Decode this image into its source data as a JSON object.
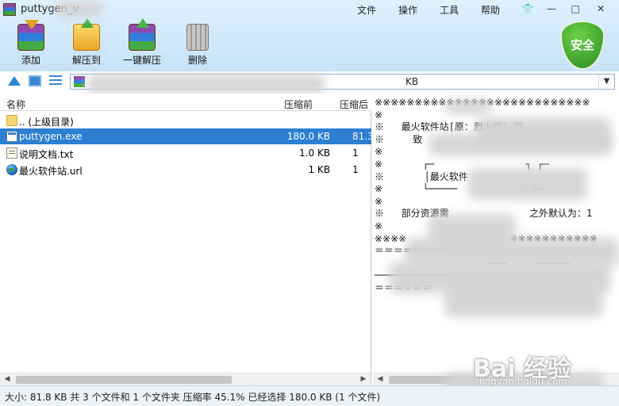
{
  "window": {
    "title": "puttygen_v",
    "menus": [
      "文件",
      "操作",
      "工具",
      "帮助"
    ],
    "controls": [
      "—",
      "□",
      "✕"
    ]
  },
  "toolbar": {
    "add_label": "添加",
    "extract_label": "解压到",
    "one_click_label": "一键解压",
    "delete_label": "删除"
  },
  "security_badge": "安全",
  "address": {
    "path_suffix": "KB"
  },
  "list": {
    "columns": [
      "名称",
      "压缩前",
      "压缩后"
    ],
    "rows": [
      {
        "name": ".. (上级目录)",
        "size": "",
        "packed": "",
        "icon": "folder-icon"
      },
      {
        "name": "puttygen.exe",
        "size": "180.0 KB",
        "packed": "81.3",
        "icon": "exe-icon",
        "selected": true
      },
      {
        "name": "说明文档.txt",
        "size": "1.0 KB",
        "packed": "1",
        "icon": "text-file-icon"
      },
      {
        "name": "最火软件站.url",
        "size": "1 KB",
        "packed": "1",
        "icon": "globe-icon"
      }
    ]
  },
  "preview": {
    "lines": [
      "※※※※※※※※※※※※※※※※※※※※※※※※※※※",
      "※",
      "※   最火软件站[原：烈火网]-同",
      "※     致",
      "※",
      "※       ┌─                ┐ ┌─",
      "※       │最火软件",
      "※       └─────           ┘ └─",
      "※",
      "※   部分资源需              之外默认为：1",
      "※",
      "※※※※                  ※※※※※※※※※※※",
      "＝＝＝＝＝＝＝＝",
      "                    ───     ──────",
      "──────────────",
      "＝＝＝＝＝＝"
    ]
  },
  "status": "大小: 81.8 KB 共 3 个文件和 1 个文件夹 压缩率 45.1% 已经选择 180.0 KB (1 个文件)",
  "watermark": {
    "brand": "Bai 经验",
    "url": "jingyan.baidu.com"
  }
}
